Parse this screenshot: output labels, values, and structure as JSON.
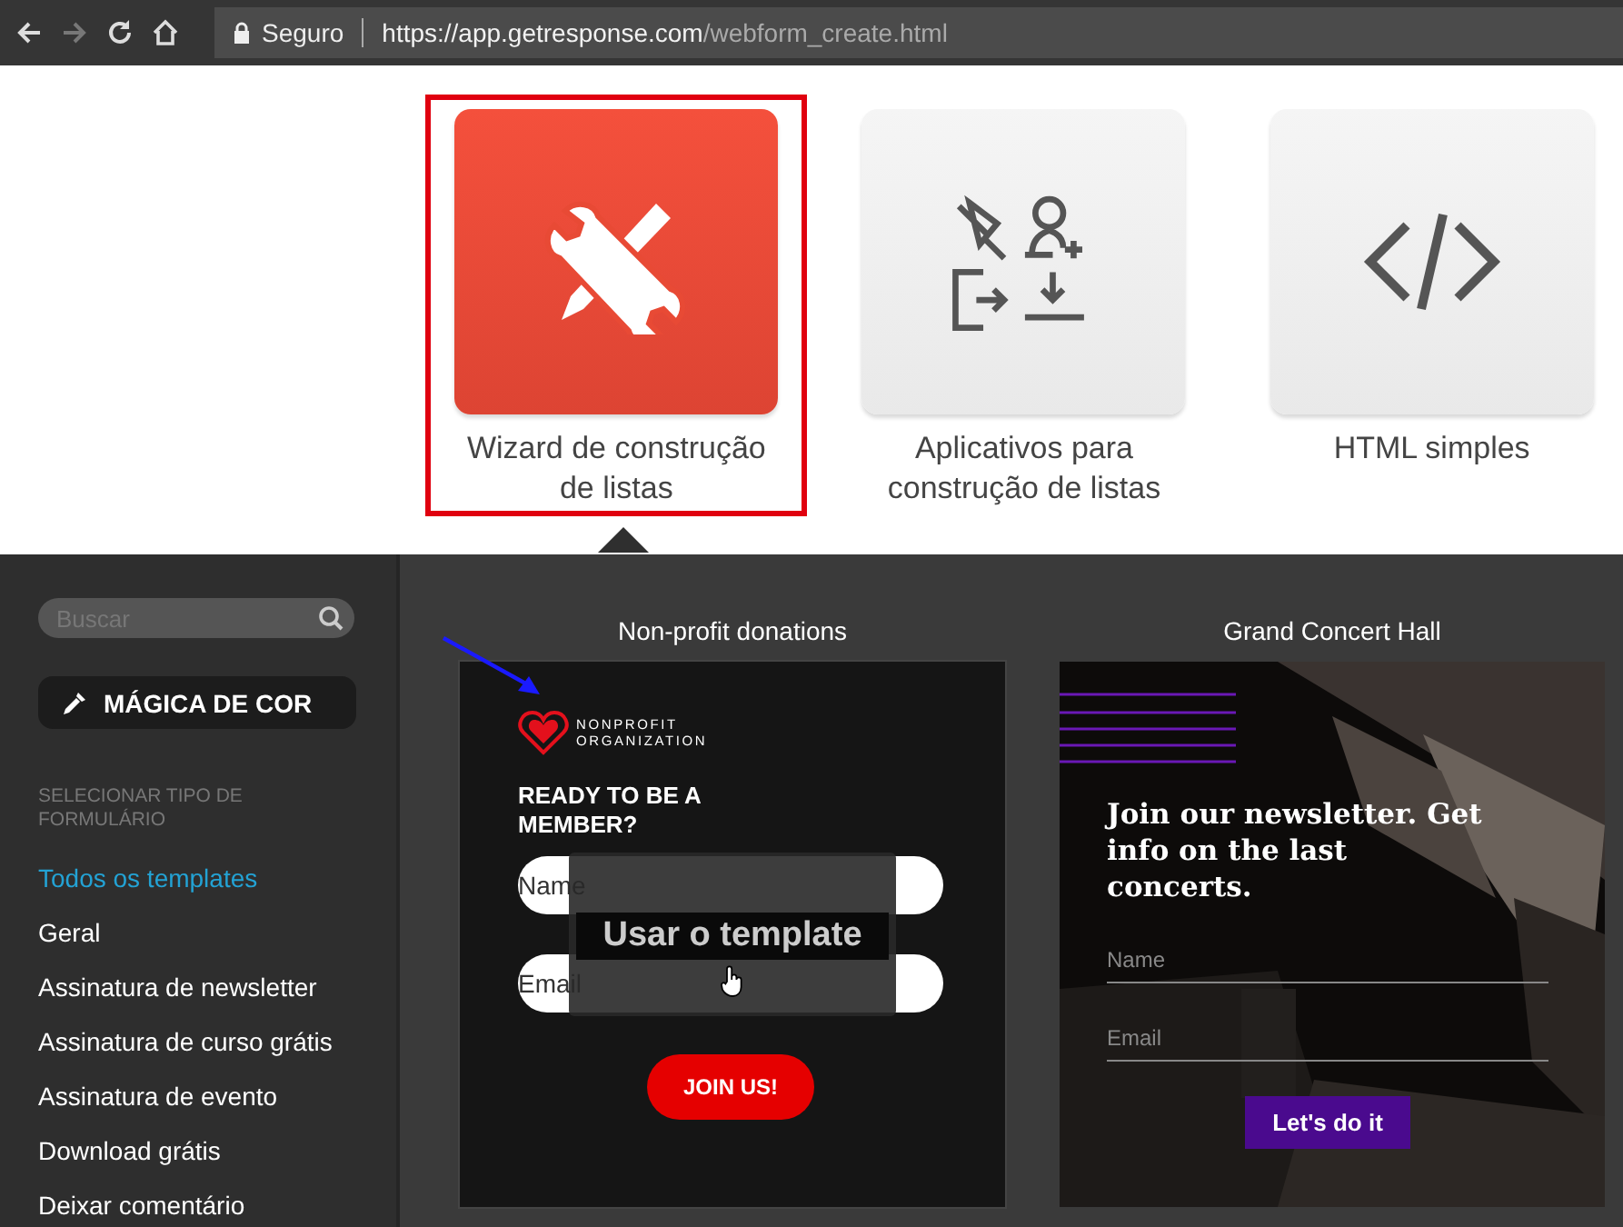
{
  "browser": {
    "security_label": "Seguro",
    "url_host": "https://app.getresponse.com",
    "url_path": "/webform_create.html"
  },
  "options": [
    {
      "label": "Wizard de construção de listas",
      "kind": "wizard",
      "selected": true
    },
    {
      "label": "Aplicativos para construção de listas",
      "kind": "apps",
      "selected": false
    },
    {
      "label": "HTML simples",
      "kind": "html",
      "selected": false
    }
  ],
  "sidebar": {
    "search": {
      "placeholder": "Buscar"
    },
    "magic_button": "MÁGICA DE COR",
    "section_title": "SELECIONAR TIPO DE FORMULÁRIO",
    "items": [
      {
        "label": "Todos os templates",
        "selected": true
      },
      {
        "label": "Geral",
        "selected": false
      },
      {
        "label": "Assinatura de newsletter",
        "selected": false
      },
      {
        "label": "Assinatura de curso grátis",
        "selected": false
      },
      {
        "label": "Assinatura de evento",
        "selected": false
      },
      {
        "label": "Download grátis",
        "selected": false
      },
      {
        "label": "Deixar comentário",
        "selected": false
      }
    ]
  },
  "templates": [
    {
      "title": "Non-profit donations",
      "kind": "nonprofit",
      "hovered": true,
      "hover_label": "Usar o template",
      "logo_line1": "NONPROFIT",
      "logo_line2": "ORGANIZATION",
      "heading": "READY TO BE A MEMBER?",
      "name_placeholder": "Name",
      "email_placeholder": "Email",
      "button": "JOIN US!"
    },
    {
      "title": "Grand Concert Hall",
      "kind": "concert",
      "hovered": false,
      "heading": "Join our newsletter. Get info on the last concerts.",
      "name_placeholder": "Name",
      "email_placeholder": "Email",
      "button": "Let's do it"
    }
  ]
}
